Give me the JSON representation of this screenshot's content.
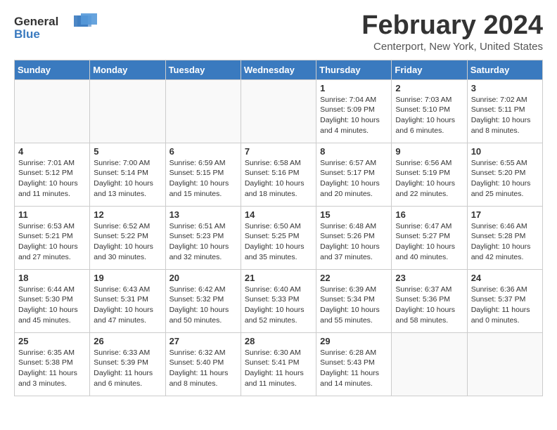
{
  "header": {
    "logo_general": "General",
    "logo_blue": "Blue",
    "month": "February 2024",
    "location": "Centerport, New York, United States"
  },
  "calendar": {
    "days_of_week": [
      "Sunday",
      "Monday",
      "Tuesday",
      "Wednesday",
      "Thursday",
      "Friday",
      "Saturday"
    ],
    "weeks": [
      [
        {
          "day": "",
          "info": ""
        },
        {
          "day": "",
          "info": ""
        },
        {
          "day": "",
          "info": ""
        },
        {
          "day": "",
          "info": ""
        },
        {
          "day": "1",
          "info": "Sunrise: 7:04 AM\nSunset: 5:09 PM\nDaylight: 10 hours\nand 4 minutes."
        },
        {
          "day": "2",
          "info": "Sunrise: 7:03 AM\nSunset: 5:10 PM\nDaylight: 10 hours\nand 6 minutes."
        },
        {
          "day": "3",
          "info": "Sunrise: 7:02 AM\nSunset: 5:11 PM\nDaylight: 10 hours\nand 8 minutes."
        }
      ],
      [
        {
          "day": "4",
          "info": "Sunrise: 7:01 AM\nSunset: 5:12 PM\nDaylight: 10 hours\nand 11 minutes."
        },
        {
          "day": "5",
          "info": "Sunrise: 7:00 AM\nSunset: 5:14 PM\nDaylight: 10 hours\nand 13 minutes."
        },
        {
          "day": "6",
          "info": "Sunrise: 6:59 AM\nSunset: 5:15 PM\nDaylight: 10 hours\nand 15 minutes."
        },
        {
          "day": "7",
          "info": "Sunrise: 6:58 AM\nSunset: 5:16 PM\nDaylight: 10 hours\nand 18 minutes."
        },
        {
          "day": "8",
          "info": "Sunrise: 6:57 AM\nSunset: 5:17 PM\nDaylight: 10 hours\nand 20 minutes."
        },
        {
          "day": "9",
          "info": "Sunrise: 6:56 AM\nSunset: 5:19 PM\nDaylight: 10 hours\nand 22 minutes."
        },
        {
          "day": "10",
          "info": "Sunrise: 6:55 AM\nSunset: 5:20 PM\nDaylight: 10 hours\nand 25 minutes."
        }
      ],
      [
        {
          "day": "11",
          "info": "Sunrise: 6:53 AM\nSunset: 5:21 PM\nDaylight: 10 hours\nand 27 minutes."
        },
        {
          "day": "12",
          "info": "Sunrise: 6:52 AM\nSunset: 5:22 PM\nDaylight: 10 hours\nand 30 minutes."
        },
        {
          "day": "13",
          "info": "Sunrise: 6:51 AM\nSunset: 5:23 PM\nDaylight: 10 hours\nand 32 minutes."
        },
        {
          "day": "14",
          "info": "Sunrise: 6:50 AM\nSunset: 5:25 PM\nDaylight: 10 hours\nand 35 minutes."
        },
        {
          "day": "15",
          "info": "Sunrise: 6:48 AM\nSunset: 5:26 PM\nDaylight: 10 hours\nand 37 minutes."
        },
        {
          "day": "16",
          "info": "Sunrise: 6:47 AM\nSunset: 5:27 PM\nDaylight: 10 hours\nand 40 minutes."
        },
        {
          "day": "17",
          "info": "Sunrise: 6:46 AM\nSunset: 5:28 PM\nDaylight: 10 hours\nand 42 minutes."
        }
      ],
      [
        {
          "day": "18",
          "info": "Sunrise: 6:44 AM\nSunset: 5:30 PM\nDaylight: 10 hours\nand 45 minutes."
        },
        {
          "day": "19",
          "info": "Sunrise: 6:43 AM\nSunset: 5:31 PM\nDaylight: 10 hours\nand 47 minutes."
        },
        {
          "day": "20",
          "info": "Sunrise: 6:42 AM\nSunset: 5:32 PM\nDaylight: 10 hours\nand 50 minutes."
        },
        {
          "day": "21",
          "info": "Sunrise: 6:40 AM\nSunset: 5:33 PM\nDaylight: 10 hours\nand 52 minutes."
        },
        {
          "day": "22",
          "info": "Sunrise: 6:39 AM\nSunset: 5:34 PM\nDaylight: 10 hours\nand 55 minutes."
        },
        {
          "day": "23",
          "info": "Sunrise: 6:37 AM\nSunset: 5:36 PM\nDaylight: 10 hours\nand 58 minutes."
        },
        {
          "day": "24",
          "info": "Sunrise: 6:36 AM\nSunset: 5:37 PM\nDaylight: 11 hours\nand 0 minutes."
        }
      ],
      [
        {
          "day": "25",
          "info": "Sunrise: 6:35 AM\nSunset: 5:38 PM\nDaylight: 11 hours\nand 3 minutes."
        },
        {
          "day": "26",
          "info": "Sunrise: 6:33 AM\nSunset: 5:39 PM\nDaylight: 11 hours\nand 6 minutes."
        },
        {
          "day": "27",
          "info": "Sunrise: 6:32 AM\nSunset: 5:40 PM\nDaylight: 11 hours\nand 8 minutes."
        },
        {
          "day": "28",
          "info": "Sunrise: 6:30 AM\nSunset: 5:41 PM\nDaylight: 11 hours\nand 11 minutes."
        },
        {
          "day": "29",
          "info": "Sunrise: 6:28 AM\nSunset: 5:43 PM\nDaylight: 11 hours\nand 14 minutes."
        },
        {
          "day": "",
          "info": ""
        },
        {
          "day": "",
          "info": ""
        }
      ]
    ]
  }
}
